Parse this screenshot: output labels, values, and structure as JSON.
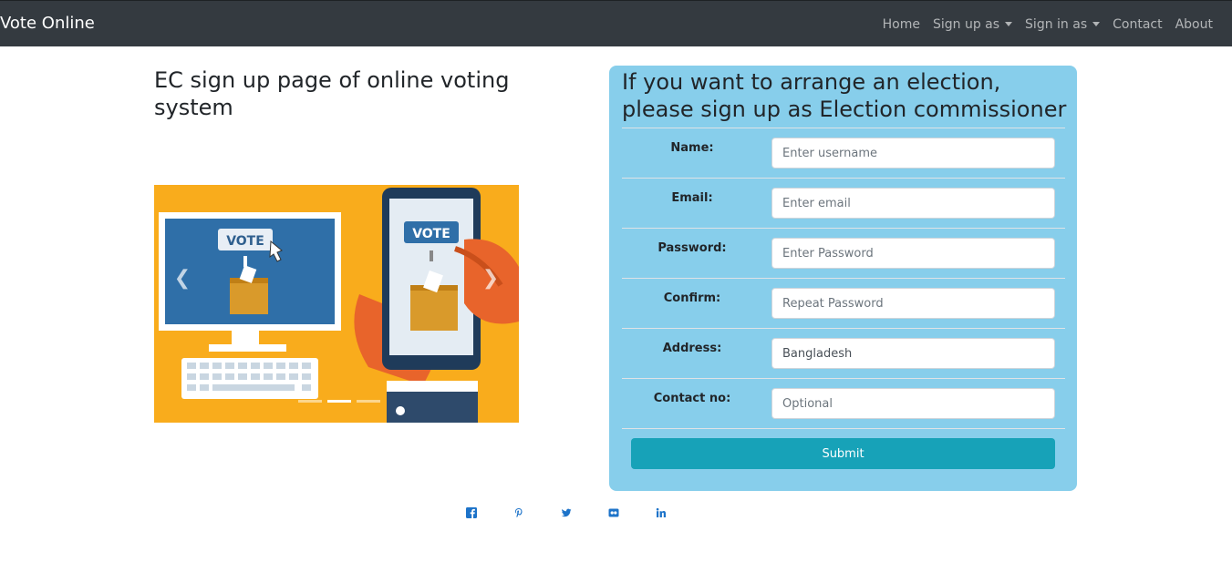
{
  "navbar": {
    "brand": "Vote Online",
    "items": [
      {
        "label": "Home"
      },
      {
        "label": "Sign up as"
      },
      {
        "label": "Sign in as"
      },
      {
        "label": "Contact"
      },
      {
        "label": "About"
      }
    ]
  },
  "left": {
    "title": "EC sign up page of online voting system",
    "carousel": {
      "vote_label": "VOTE",
      "prev_icon": "chevron-left-icon",
      "next_icon": "chevron-right-icon",
      "indicators": 3,
      "active_indicator": 2
    }
  },
  "form": {
    "title": "If you want to arrange an election, please sign up as Election commissioner",
    "fields": [
      {
        "label": "Name:",
        "placeholder": "Enter username",
        "value": ""
      },
      {
        "label": "Email:",
        "placeholder": "Enter email",
        "value": ""
      },
      {
        "label": "Password:",
        "placeholder": "Enter Password",
        "value": ""
      },
      {
        "label": "Confirm:",
        "placeholder": "Repeat Password",
        "value": ""
      },
      {
        "label": "Address:",
        "placeholder": "",
        "value": "Bangladesh"
      },
      {
        "label": "Contact no:",
        "placeholder": "Optional",
        "value": ""
      }
    ],
    "submit_label": "Submit"
  },
  "social": [
    "facebook-icon",
    "pinterest-icon",
    "twitter-icon",
    "flickr-icon",
    "linkedin-icon"
  ],
  "colors": {
    "navbar": "#343a40",
    "panel": "#87ceeb",
    "submit": "#17a2b8",
    "carousel_bg": "#f9ac1c",
    "social": "#1d73c9"
  }
}
